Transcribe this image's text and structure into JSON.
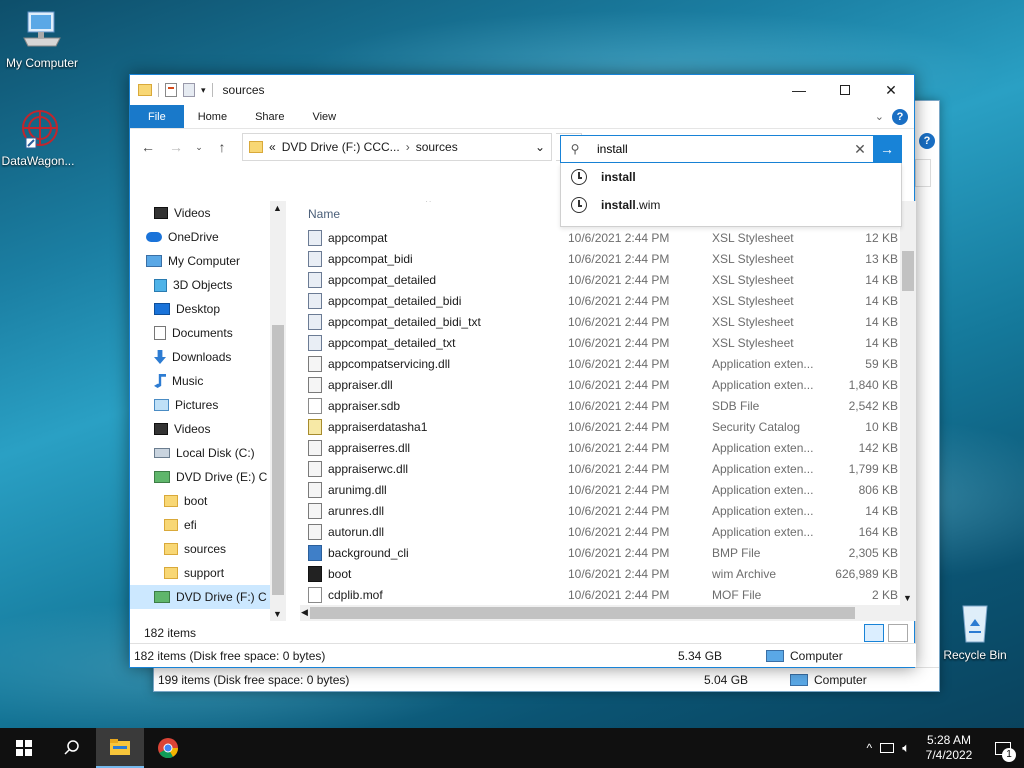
{
  "desktop": {
    "icons": [
      {
        "label": "My Computer"
      },
      {
        "label": "DataWagon..."
      },
      {
        "label": "Recycle Bin"
      }
    ]
  },
  "back_window": {
    "status_items": "199 items (Disk free space: 0 bytes)",
    "status_size": "5.04 GB",
    "status_location": "Computer"
  },
  "window": {
    "title": "sources",
    "ribbon_tabs": [
      "File",
      "Home",
      "Share",
      "View"
    ],
    "address": {
      "prefix": "«",
      "segment1": "DVD Drive (F:) CCC...",
      "segment2": "sources"
    },
    "search": {
      "value": "install",
      "suggestions": [
        {
          "bold": "install",
          "rest": ""
        },
        {
          "bold": "install",
          "rest": ".wim"
        }
      ]
    },
    "nav_items": [
      {
        "label": "Videos",
        "icon": "video-icon"
      },
      {
        "label": "OneDrive",
        "icon": "cloud-icon"
      },
      {
        "label": "My Computer",
        "icon": "computer-icon"
      },
      {
        "label": "3D Objects",
        "icon": "cube-icon"
      },
      {
        "label": "Desktop",
        "icon": "desktop-icon"
      },
      {
        "label": "Documents",
        "icon": "document-icon"
      },
      {
        "label": "Downloads",
        "icon": "download-icon"
      },
      {
        "label": "Music",
        "icon": "music-icon"
      },
      {
        "label": "Pictures",
        "icon": "picture-icon"
      },
      {
        "label": "Videos",
        "icon": "video-icon"
      },
      {
        "label": "Local Disk (C:)",
        "icon": "disk-icon"
      },
      {
        "label": "DVD Drive (E:) C",
        "icon": "dvd-icon"
      },
      {
        "label": "boot",
        "icon": "folder-icon"
      },
      {
        "label": "efi",
        "icon": "folder-icon"
      },
      {
        "label": "sources",
        "icon": "folder-icon"
      },
      {
        "label": "support",
        "icon": "folder-icon"
      },
      {
        "label": "DVD Drive (F:) C",
        "icon": "dvd-icon"
      }
    ],
    "column_name": "Name",
    "files": [
      {
        "name": "appcompat",
        "date": "10/6/2021 2:44 PM",
        "type": "XSL Stylesheet",
        "size": "12 KB",
        "kind": "xsl"
      },
      {
        "name": "appcompat_bidi",
        "date": "10/6/2021 2:44 PM",
        "type": "XSL Stylesheet",
        "size": "13 KB",
        "kind": "xsl"
      },
      {
        "name": "appcompat_detailed",
        "date": "10/6/2021 2:44 PM",
        "type": "XSL Stylesheet",
        "size": "14 KB",
        "kind": "xsl"
      },
      {
        "name": "appcompat_detailed_bidi",
        "date": "10/6/2021 2:44 PM",
        "type": "XSL Stylesheet",
        "size": "14 KB",
        "kind": "xsl"
      },
      {
        "name": "appcompat_detailed_bidi_txt",
        "date": "10/6/2021 2:44 PM",
        "type": "XSL Stylesheet",
        "size": "14 KB",
        "kind": "xsl"
      },
      {
        "name": "appcompat_detailed_txt",
        "date": "10/6/2021 2:44 PM",
        "type": "XSL Stylesheet",
        "size": "14 KB",
        "kind": "xsl"
      },
      {
        "name": "appcompatservicing.dll",
        "date": "10/6/2021 2:44 PM",
        "type": "Application exten...",
        "size": "59 KB",
        "kind": "dll"
      },
      {
        "name": "appraiser.dll",
        "date": "10/6/2021 2:44 PM",
        "type": "Application exten...",
        "size": "1,840 KB",
        "kind": "dll"
      },
      {
        "name": "appraiser.sdb",
        "date": "10/6/2021 2:44 PM",
        "type": "SDB File",
        "size": "2,542 KB",
        "kind": "file"
      },
      {
        "name": "appraiserdatasha1",
        "date": "10/6/2021 2:44 PM",
        "type": "Security Catalog",
        "size": "10 KB",
        "kind": "cat"
      },
      {
        "name": "appraiserres.dll",
        "date": "10/6/2021 2:44 PM",
        "type": "Application exten...",
        "size": "142 KB",
        "kind": "dll"
      },
      {
        "name": "appraiserwc.dll",
        "date": "10/6/2021 2:44 PM",
        "type": "Application exten...",
        "size": "1,799 KB",
        "kind": "dll"
      },
      {
        "name": "arunimg.dll",
        "date": "10/6/2021 2:44 PM",
        "type": "Application exten...",
        "size": "806 KB",
        "kind": "dll"
      },
      {
        "name": "arunres.dll",
        "date": "10/6/2021 2:44 PM",
        "type": "Application exten...",
        "size": "14 KB",
        "kind": "dll"
      },
      {
        "name": "autorun.dll",
        "date": "10/6/2021 2:44 PM",
        "type": "Application exten...",
        "size": "164 KB",
        "kind": "dll"
      },
      {
        "name": "background_cli",
        "date": "10/6/2021 2:44 PM",
        "type": "BMP File",
        "size": "2,305 KB",
        "kind": "bmp"
      },
      {
        "name": "boot",
        "date": "10/6/2021 2:44 PM",
        "type": "wim Archive",
        "size": "626,989 KB",
        "kind": "wim"
      },
      {
        "name": "cdplib.mof",
        "date": "10/6/2021 2:44 PM",
        "type": "MOF File",
        "size": "2 KB",
        "kind": "file"
      }
    ],
    "item_count": "182 items",
    "status_items": "182 items (Disk free space: 0 bytes)",
    "status_size": "5.34 GB",
    "status_location": "Computer"
  },
  "taskbar": {
    "time": "5:28 AM",
    "date": "7/4/2022",
    "notification_count": "1"
  },
  "colors": {
    "accent": "#1883d7",
    "file_tab": "#1979ca",
    "selection": "#cce8ff"
  }
}
